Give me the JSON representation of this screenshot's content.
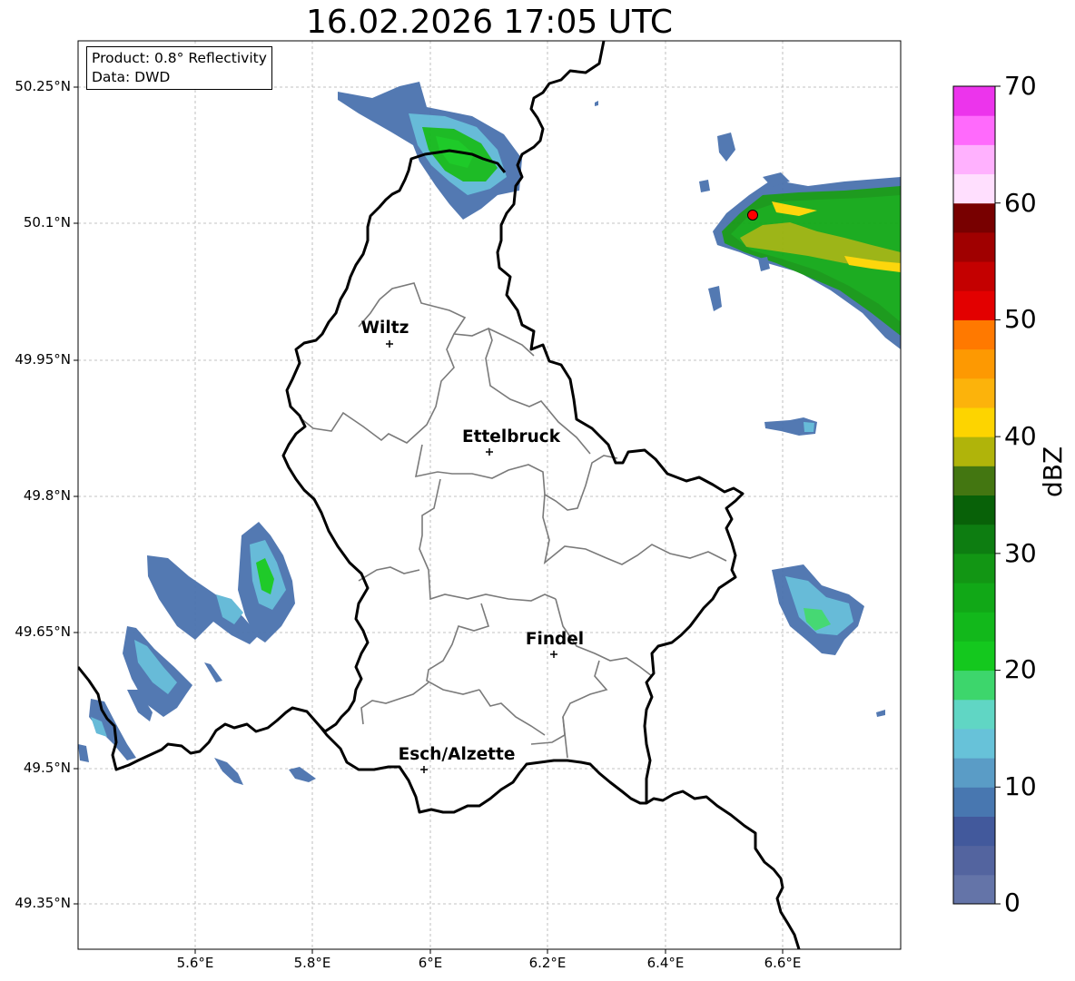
{
  "title": "16.02.2026 17:05 UTC",
  "info": {
    "product": "Product: 0.8° Reflectivity",
    "data": "Data: DWD"
  },
  "cities": [
    {
      "name": "Wiltz",
      "lon": 5.93,
      "lat": 49.969
    },
    {
      "name": "Ettelbruck",
      "lon": 6.103,
      "lat": 49.849
    },
    {
      "name": "Findel",
      "lon": 6.211,
      "lat": 49.626
    },
    {
      "name": "Esch/Alzette",
      "lon": 5.987,
      "lat": 49.499
    }
  ],
  "lat_ticks": [
    "50.25°N",
    "50.1°N",
    "49.95°N",
    "49.8°N",
    "49.65°N",
    "49.5°N",
    "49.35°N"
  ],
  "lon_ticks": [
    "5.6°E",
    "5.8°E",
    "6°E",
    "6.2°E",
    "6.4°E",
    "6.6°E"
  ],
  "colorbar": {
    "label": "dBZ",
    "ticks": [
      "0",
      "10",
      "20",
      "30",
      "40",
      "50",
      "60",
      "70"
    ],
    "colors": [
      "#6474a8",
      "#53649f",
      "#42599c",
      "#4877b0",
      "#5a9cc6",
      "#67c2d9",
      "#60d6c4",
      "#3dd66c",
      "#14c81e",
      "#12b81b",
      "#11a817",
      "#129614",
      "#0d7d11",
      "#086108",
      "#437611",
      "#b0b40a",
      "#fdd400",
      "#fcb30b",
      "#fd9902",
      "#ff7900",
      "#e30000",
      "#c40000",
      "#a00000",
      "#780000",
      "#ffdffe",
      "#ffb1fe",
      "#ff6afc",
      "#ec34ec"
    ]
  },
  "radar_site": {
    "lon": 6.548,
    "lat": 50.11
  },
  "legend_markers": {
    "city": "+",
    "radar": "red-circle"
  }
}
